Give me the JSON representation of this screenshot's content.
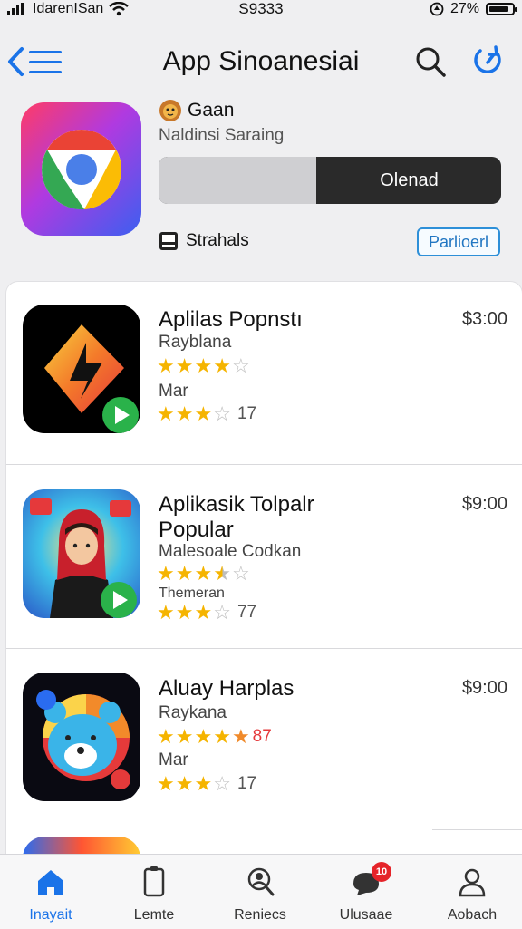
{
  "status_bar": {
    "carrier": "IdarenISan",
    "time": "S9333",
    "battery_percent": "27%",
    "battery_level": 0.9
  },
  "nav": {
    "title": "App Sinoanesiai",
    "back_icon": "chevron-left-icon",
    "menu_icon": "hamburger-icon",
    "search_icon": "search-icon",
    "refresh_icon": "refresh-icon"
  },
  "hero": {
    "name": "Gaan",
    "subtitle": "Naldinsi Saraing",
    "progress_label": "Olenad",
    "progress_fraction": 0.46,
    "stats_label": "Strahals",
    "action_label": "Parlioerl"
  },
  "apps": [
    {
      "title": "Aplilas Popnstı",
      "line1": "Rayblana",
      "rating1": 4,
      "line2": "Mar",
      "rating2": 3,
      "rating2_count": "17",
      "price": "$3:00"
    },
    {
      "title": "Aplikasik Tolpalr\nPopular",
      "line1": "Malesoale Codkan",
      "rating1": 3.5,
      "line2": "Themeran",
      "rating2": 3,
      "rating2_count": "77",
      "price": "$9:00"
    },
    {
      "title": "Aluay Harplas",
      "line1": "Raykana",
      "rating1": 4.5,
      "rating1_count": "87",
      "line2": "Mar",
      "rating2": 3,
      "rating2_count": "17",
      "price": "$9:00"
    }
  ],
  "tabs": [
    {
      "label": "Inayait",
      "icon": "home-icon",
      "active": true
    },
    {
      "label": "Lemte",
      "icon": "tablet-icon",
      "active": false
    },
    {
      "label": "Reniecs",
      "icon": "search-person-icon",
      "active": false
    },
    {
      "label": "Ulusaae",
      "icon": "chat-icon",
      "active": false,
      "badge": "10"
    },
    {
      "label": "Aobach",
      "icon": "person-icon",
      "active": false
    }
  ],
  "colors": {
    "accent": "#1a73e8",
    "star": "#f5b400",
    "badge": "#e5242a",
    "progress_dark": "#2a2a2a"
  }
}
